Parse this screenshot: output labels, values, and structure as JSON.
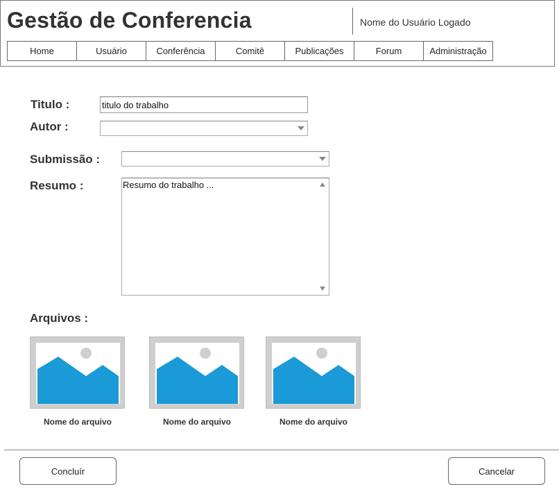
{
  "header": {
    "title": "Gestão de Conferencia",
    "user_name": "Nome do Usuário Logado"
  },
  "nav": {
    "items": [
      {
        "label": "Home"
      },
      {
        "label": "Usuário"
      },
      {
        "label": "Conferência"
      },
      {
        "label": "Comitê"
      },
      {
        "label": "Publicações"
      },
      {
        "label": "Forum"
      },
      {
        "label": "Administração"
      }
    ]
  },
  "form": {
    "titulo_label": "Titulo :",
    "titulo_value": "titulo do trabalho",
    "autor_label": "Autor :",
    "autor_value": "",
    "submissao_label": "Submissão :",
    "submissao_value": "",
    "resumo_label": "Resumo :",
    "resumo_value": "Resumo do trabalho ...",
    "arquivos_label": "Arquivos :"
  },
  "files": [
    {
      "name": "Nome do arquivo",
      "icon": "image-placeholder-icon"
    },
    {
      "name": "Nome do arquivo",
      "icon": "image-placeholder-icon"
    },
    {
      "name": "Nome do arquivo",
      "icon": "image-placeholder-icon"
    }
  ],
  "actions": {
    "concluir_label": "Concluír",
    "cancelar_label": "Cancelar"
  },
  "colors": {
    "image_blue": "#1a9ad6",
    "image_gray": "#cfcfcf"
  }
}
